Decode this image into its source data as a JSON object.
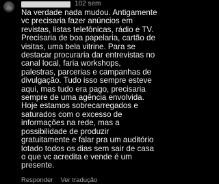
{
  "comment": {
    "time": "102 sem",
    "text": "Na verdade nada mudou. Antigamente\nvc precisaria fazer anúncios em\nrevistas, listas telefônicas, rádio e TV.\nPrecisaria de boa papelaria, cartão de\nvisitas, uma bela vitrine. Para se\ndestacar procuraria dar entrevistas no\ncanal local, faria workshops,\npalestras, parcerias e campanhas de\ndivulgação. Tudo isso sempre esteve\naqui, mas tudo era pago, precisaria\nsempre de uma agência envolvida.\nHoje estamos sobrecarregados e\nsaturados com o excesso de\ninformações na rede, mas a\npossibilidade de produzir\ngratuitamente e falar pra um auditório\nlotado todos os dias sem sair de casa\no que vc acredita e vende é um\npresente.",
    "reply_label": "Responder",
    "translate_label": "Ver tradução"
  }
}
